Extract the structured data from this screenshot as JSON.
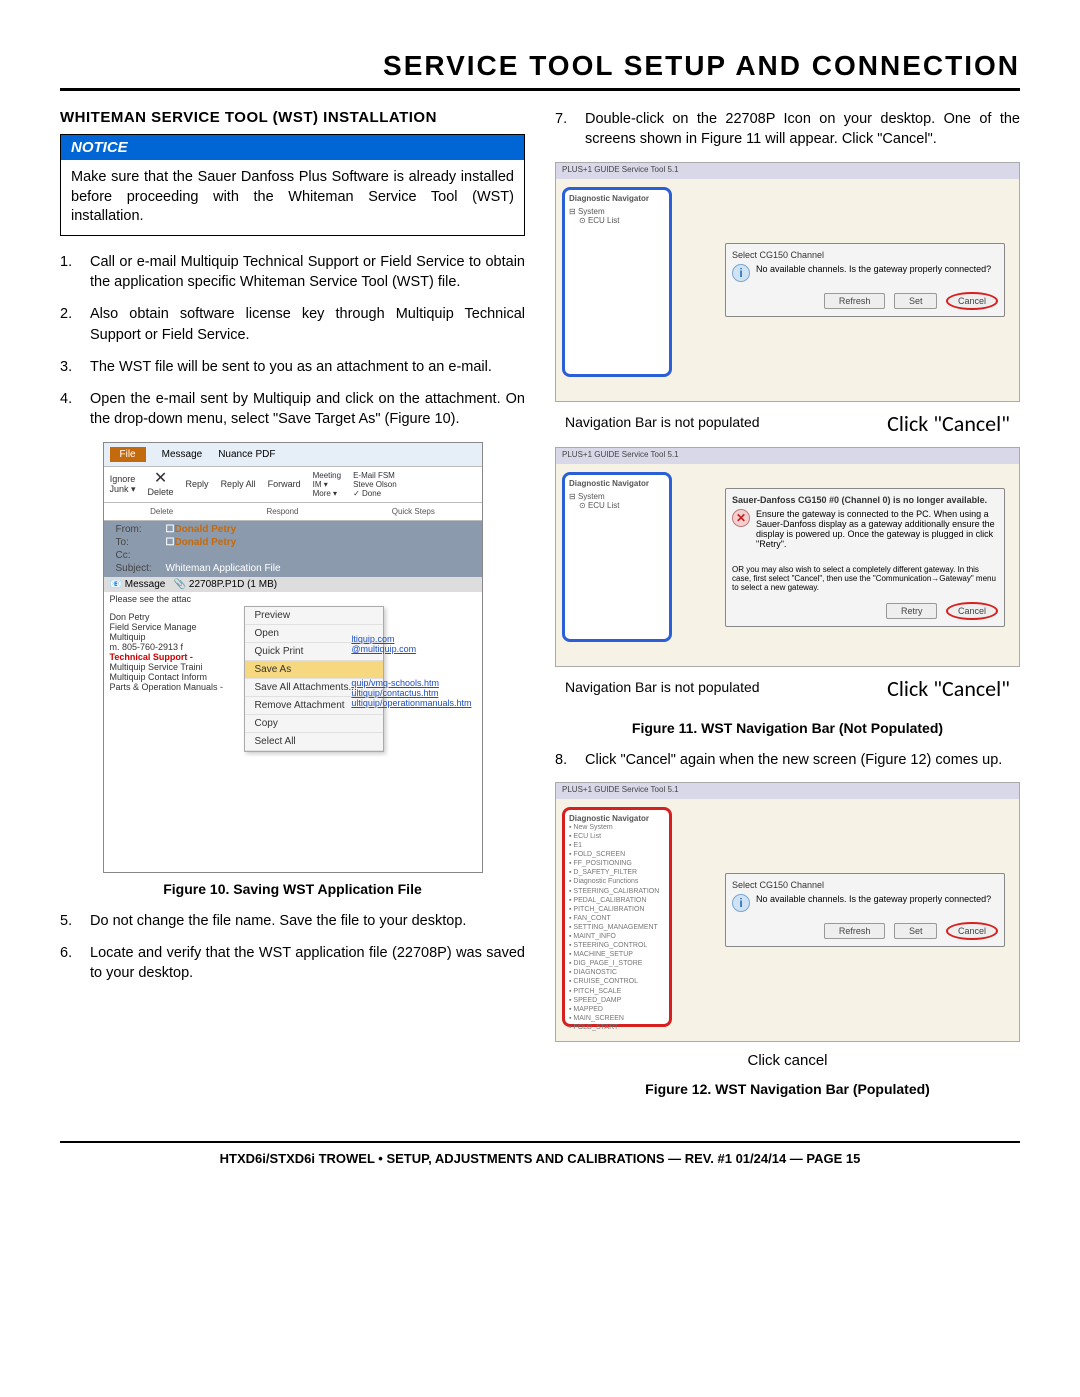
{
  "page_title": "Service Tool Setup and Connection",
  "footer": "HTXD6i/STXD6i TROWEL • SETUP, ADJUSTMENTS AND CALIBRATIONS — REV. #1 01/24/14 — PAGE 15",
  "left": {
    "heading": "WHITEMAN SERVICE TOOL (WST) INSTALLATION",
    "notice_label": "NOTICE",
    "notice_body": "Make sure that the Sauer Danfoss Plus Software is already installed before proceeding with the Whiteman Service Tool (WST) installation.",
    "steps_a": [
      "Call or e-mail Multiquip Technical Support or Field Service to obtain the application specific Whiteman Service Tool (WST) file.",
      "Also obtain software license key through Multiquip Technical Support or Field Service.",
      "The WST file will be sent to you as an attachment to an e-mail.",
      "Open the e-mail sent by Multiquip and click on the attachment. On the drop-down menu, select \"Save Target As\" (Figure 10)."
    ],
    "fig10_caption": "Figure 10. Saving WST Application File",
    "steps_b": [
      "Do not change the file name. Save the file to your desktop.",
      "Locate and verify that the WST application file (22708P) was saved to your desktop."
    ],
    "outlook": {
      "tab_file": "File",
      "tab_message": "Message",
      "tab_nuance": "Nuance PDF",
      "ignore": "Ignore",
      "junk": "Junk ▾",
      "delete": "Delete",
      "delete_group": "Delete",
      "reply": "Reply",
      "reply_all": "Reply All",
      "forward": "Forward",
      "respond_group": "Respond",
      "meeting": "Meeting",
      "im": "IM ▾",
      "more": "More ▾",
      "email_fsm": "E-Mail FSM",
      "steve": "Steve Olson",
      "done": "Done",
      "quicksteps": "Quick Steps",
      "from_l": "From:",
      "from_v": "Donald Petry",
      "to_l": "To:",
      "to_v": "Donald Petry",
      "cc_l": "Cc:",
      "subj_l": "Subject:",
      "subj_v": "Whiteman Application File",
      "msg_l": "Message",
      "msg_att": "22708P.P1D (1 MB)",
      "body_preview": "Please see the attac",
      "sig1": "Don Petry",
      "sig2": "Field Service Manage",
      "sig3": "Multiquip",
      "sig4": "m. 805-760-2913   f",
      "sig5": "Technical Support -",
      "sig6": "Multiquip Service Traini",
      "sig7": "Multiquip Contact Inform",
      "sig8": "Parts & Operation Manuals -",
      "link1": "ltiquip.com",
      "link2": "@multiquip.com",
      "link3": "quip/vmq-schools.htm",
      "link4": "ultiquip/contactus.htm",
      "link5": "ultiquip/operationmanuals.htm",
      "cm": {
        "preview": "Preview",
        "open": "Open",
        "quick_print": "Quick Print",
        "save_as": "Save As",
        "save_all": "Save All Attachments...",
        "remove": "Remove Attachment",
        "copy": "Copy",
        "select_all": "Select All"
      }
    }
  },
  "right": {
    "step7": "Double-click on the 22708P Icon on your desktop. One of the screens shown in Figure 11 will appear. Click \"Cancel\".",
    "step8": "Click \"Cancel\" again when the new screen (Figure 12) comes up.",
    "fig11_caption": "Figure 11. WST Navigation Bar (Not Populated)",
    "fig12_caption": "Figure 12. WST Navigation Bar (Populated)",
    "wst_title": "PLUS+1 GUIDE Service Tool 5.1",
    "diag_nav": "Diagnostic Navigator",
    "tree1": "System",
    "tree2": "ECU List",
    "dlg1_title": "Select CG150 Channel",
    "dlg1_msg": "No available channels. Is the gateway properly connected?",
    "dlg2_title": "Sauer-Danfoss CG150 #0 (Channel 0) is no longer available.",
    "dlg2_msg": "Ensure the gateway is connected to the PC. When using a Sauer-Danfoss display as a gateway additionally ensure the display is powered up. Once the gateway is plugged in click \"Retry\".",
    "dlg2_foot": "OR you may also wish to select a completely different gateway. In this case, first select \"Cancel\", then use the \"Communication→Gateway\" menu to select a new gateway.",
    "btn_refresh": "Refresh",
    "btn_set": "Set",
    "btn_cancel": "Cancel",
    "btn_retry": "Retry",
    "annot_left": "Navigation Bar is not populated",
    "annot_right": "Click \"Cancel\"",
    "annot_click_cancel": "Click cancel",
    "populated_items": [
      "New System",
      "ECU List",
      "E1",
      "FOLD_SCREEN",
      "FF_POSITIONING",
      "D_SAFETY_FILTER",
      "Diagnostic Functions",
      "STEERING_CALIBRATION",
      "PEDAL_CALIBRATION",
      "PITCH_CALIBRATION",
      "FAN_CONT",
      "SETTING_MANAGEMENT",
      "MAINT_INFO",
      "STEERING_CONTROL",
      "MACHINE_SETUP",
      "DIG_PAGE_I_STORE",
      "DIAGNOSTIC",
      "CRUISE_CONTROL",
      "PITCH_SCALE",
      "SPEED_DAMP",
      "MAPPED",
      "MAIN_SCREEN",
      "FOLD_START"
    ]
  }
}
